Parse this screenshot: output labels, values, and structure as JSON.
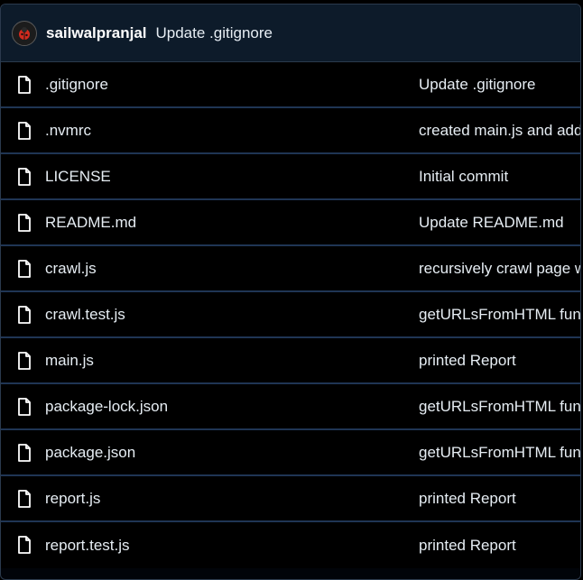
{
  "header": {
    "author": "sailwalpranjal",
    "commit_message": "Update .gitignore"
  },
  "files": [
    {
      "name": ".gitignore",
      "message": "Update .gitignore"
    },
    {
      "name": ".nvmrc",
      "message": "created main.js and add"
    },
    {
      "name": "LICENSE",
      "message": "Initial commit"
    },
    {
      "name": "README.md",
      "message": "Update README.md"
    },
    {
      "name": "crawl.js",
      "message": "recursively crawl page w"
    },
    {
      "name": "crawl.test.js",
      "message": "getURLsFromHTML func"
    },
    {
      "name": "main.js",
      "message": "printed Report"
    },
    {
      "name": "package-lock.json",
      "message": "getURLsFromHTML func"
    },
    {
      "name": "package.json",
      "message": "getURLsFromHTML func"
    },
    {
      "name": "report.js",
      "message": "printed Report"
    },
    {
      "name": "report.test.js",
      "message": "printed Report"
    }
  ]
}
